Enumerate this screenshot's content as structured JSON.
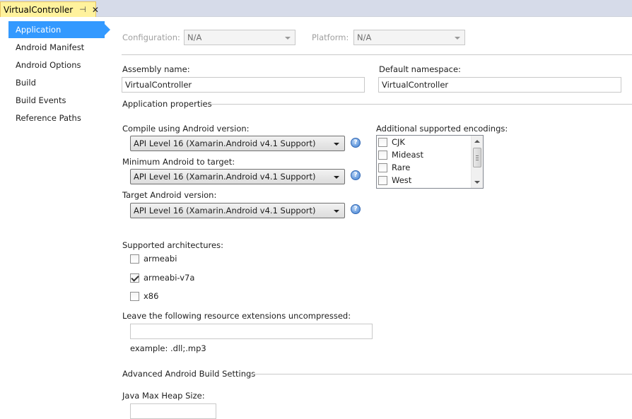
{
  "tab": {
    "title": "VirtualController",
    "pin": "⊣",
    "close": "✕"
  },
  "sidebar": {
    "items": [
      {
        "label": "Application"
      },
      {
        "label": "Android Manifest"
      },
      {
        "label": "Android Options"
      },
      {
        "label": "Build"
      },
      {
        "label": "Build Events"
      },
      {
        "label": "Reference Paths"
      }
    ],
    "active_index": 0
  },
  "config": {
    "configuration_label": "Configuration:",
    "configuration_value": "N/A",
    "platform_label": "Platform:",
    "platform_value": "N/A"
  },
  "assembly": {
    "label": "Assembly name:",
    "value": "VirtualController"
  },
  "namespace": {
    "label": "Default namespace:",
    "value": "VirtualController"
  },
  "app_props": {
    "heading": "Application properties"
  },
  "compile": {
    "label": "Compile using Android version:",
    "value": "API Level 16 (Xamarin.Android v4.1 Support)"
  },
  "min_android": {
    "label": "Minimum Android to target:",
    "value": "API Level 16 (Xamarin.Android v4.1 Support)"
  },
  "target_android": {
    "label": "Target Android version:",
    "value": "API Level 16 (Xamarin.Android v4.1 Support)"
  },
  "help_glyph": "?",
  "encodings": {
    "label": "Additional supported encodings:",
    "items": [
      {
        "label": "CJK",
        "checked": false
      },
      {
        "label": "Mideast",
        "checked": false
      },
      {
        "label": "Rare",
        "checked": false
      },
      {
        "label": "West",
        "checked": false
      }
    ]
  },
  "architectures": {
    "label": "Supported architectures:",
    "items": [
      {
        "label": "armeabi",
        "checked": false
      },
      {
        "label": "armeabi-v7a",
        "checked": true
      },
      {
        "label": "x86",
        "checked": false
      }
    ]
  },
  "uncompressed": {
    "label": "Leave the following resource extensions uncompressed:",
    "value": "",
    "example": "example: .dll;.mp3"
  },
  "advanced": {
    "heading": "Advanced Android Build Settings"
  },
  "heap": {
    "label": "Java Max Heap Size:",
    "value": ""
  },
  "colors": {
    "accent": "#3399ff",
    "tab_bg": "#fff29d",
    "tab_strip": "#d6dbe9"
  }
}
